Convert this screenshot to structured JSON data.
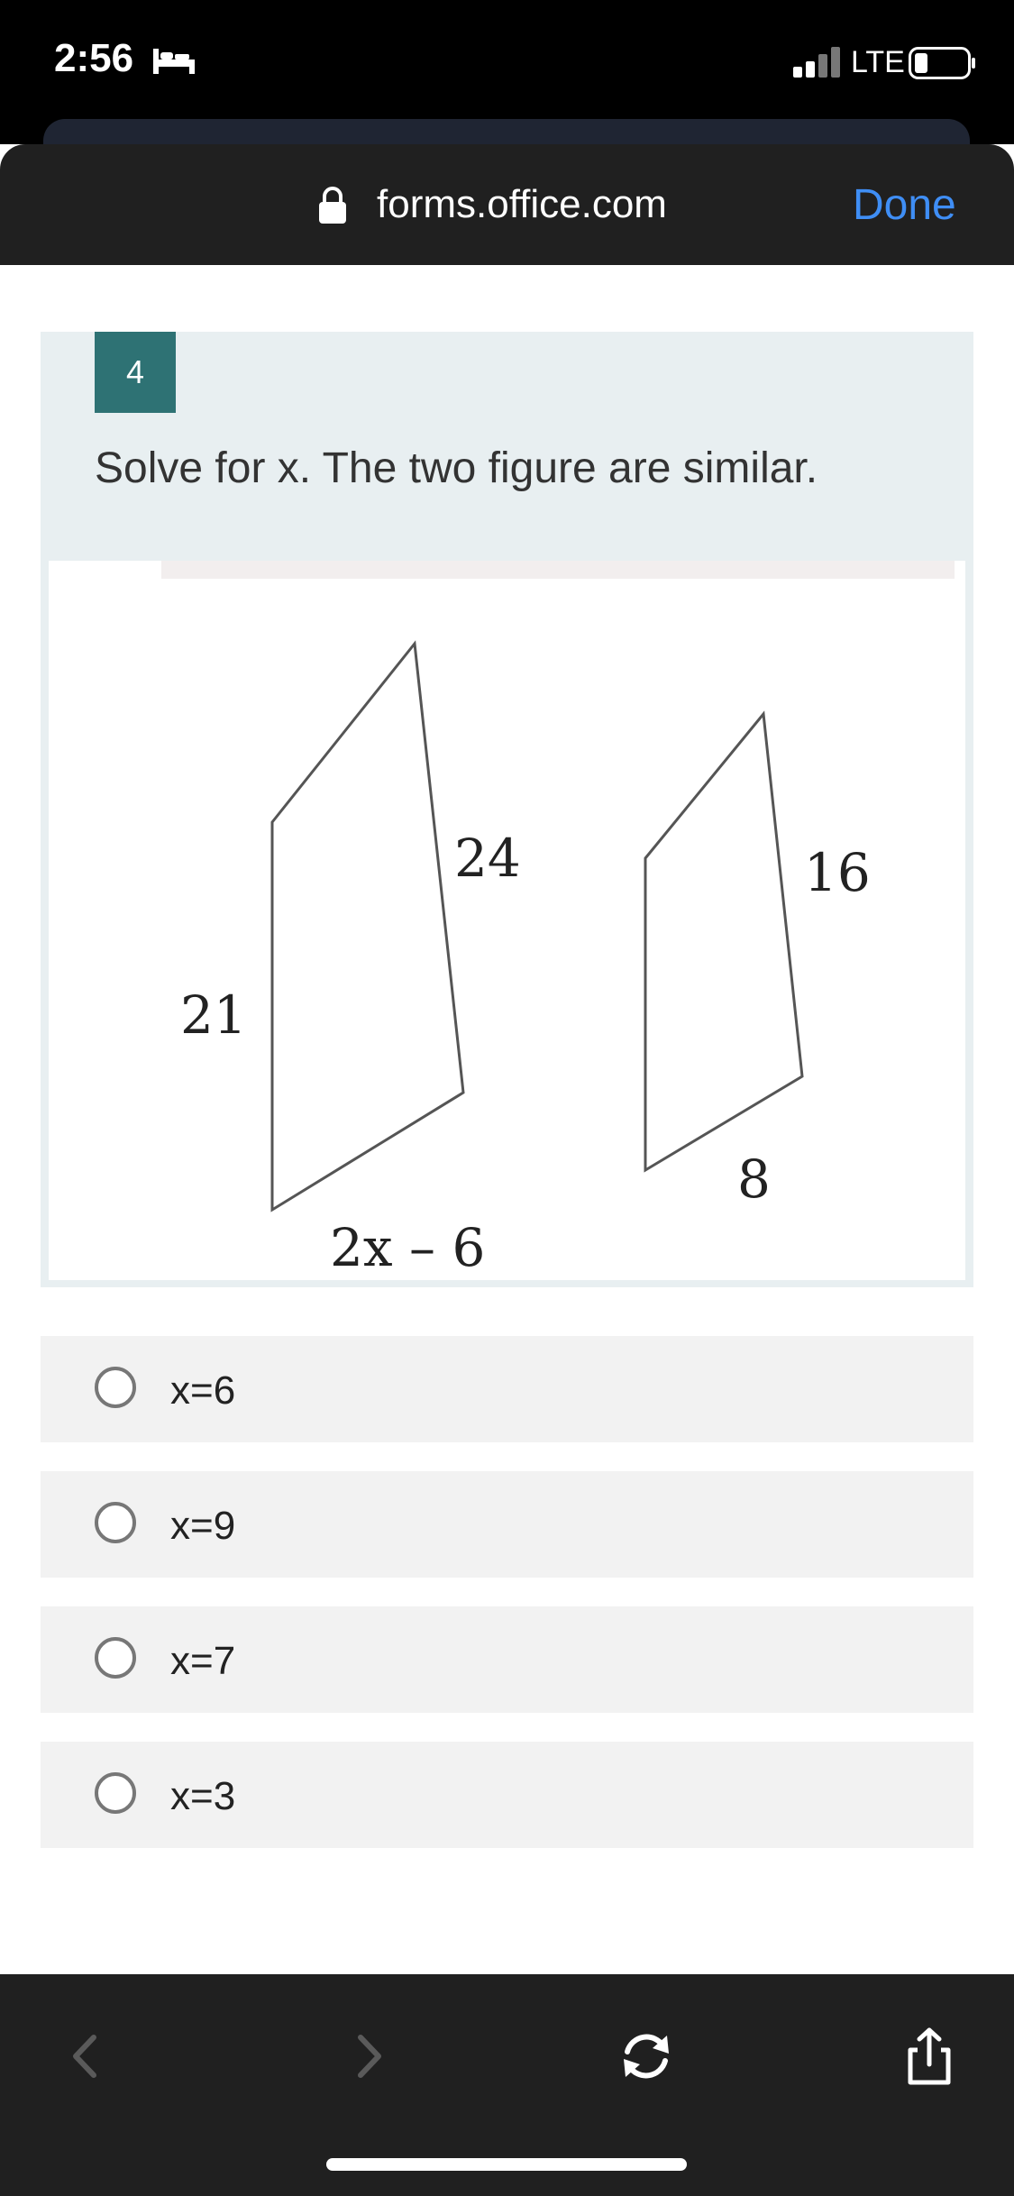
{
  "status_bar": {
    "time": "2:56",
    "network": "LTE"
  },
  "browser": {
    "url": "forms.office.com",
    "done_label": "Done",
    "accent_color": "#3f8ef5"
  },
  "question": {
    "number": "4",
    "text": "Solve for x. The two figure are similar.",
    "figure": {
      "left_shape": {
        "side_left": "21",
        "side_right": "24",
        "side_bottom": "2x – 6"
      },
      "right_shape": {
        "side_right": "16",
        "side_bottom": "8"
      }
    },
    "options": [
      {
        "label": "x=6"
      },
      {
        "label": "x=9"
      },
      {
        "label": "x=7"
      },
      {
        "label": "x=3"
      }
    ]
  },
  "toolbar": {
    "icons": [
      "back-icon",
      "forward-icon",
      "reload-icon",
      "share-icon"
    ]
  }
}
